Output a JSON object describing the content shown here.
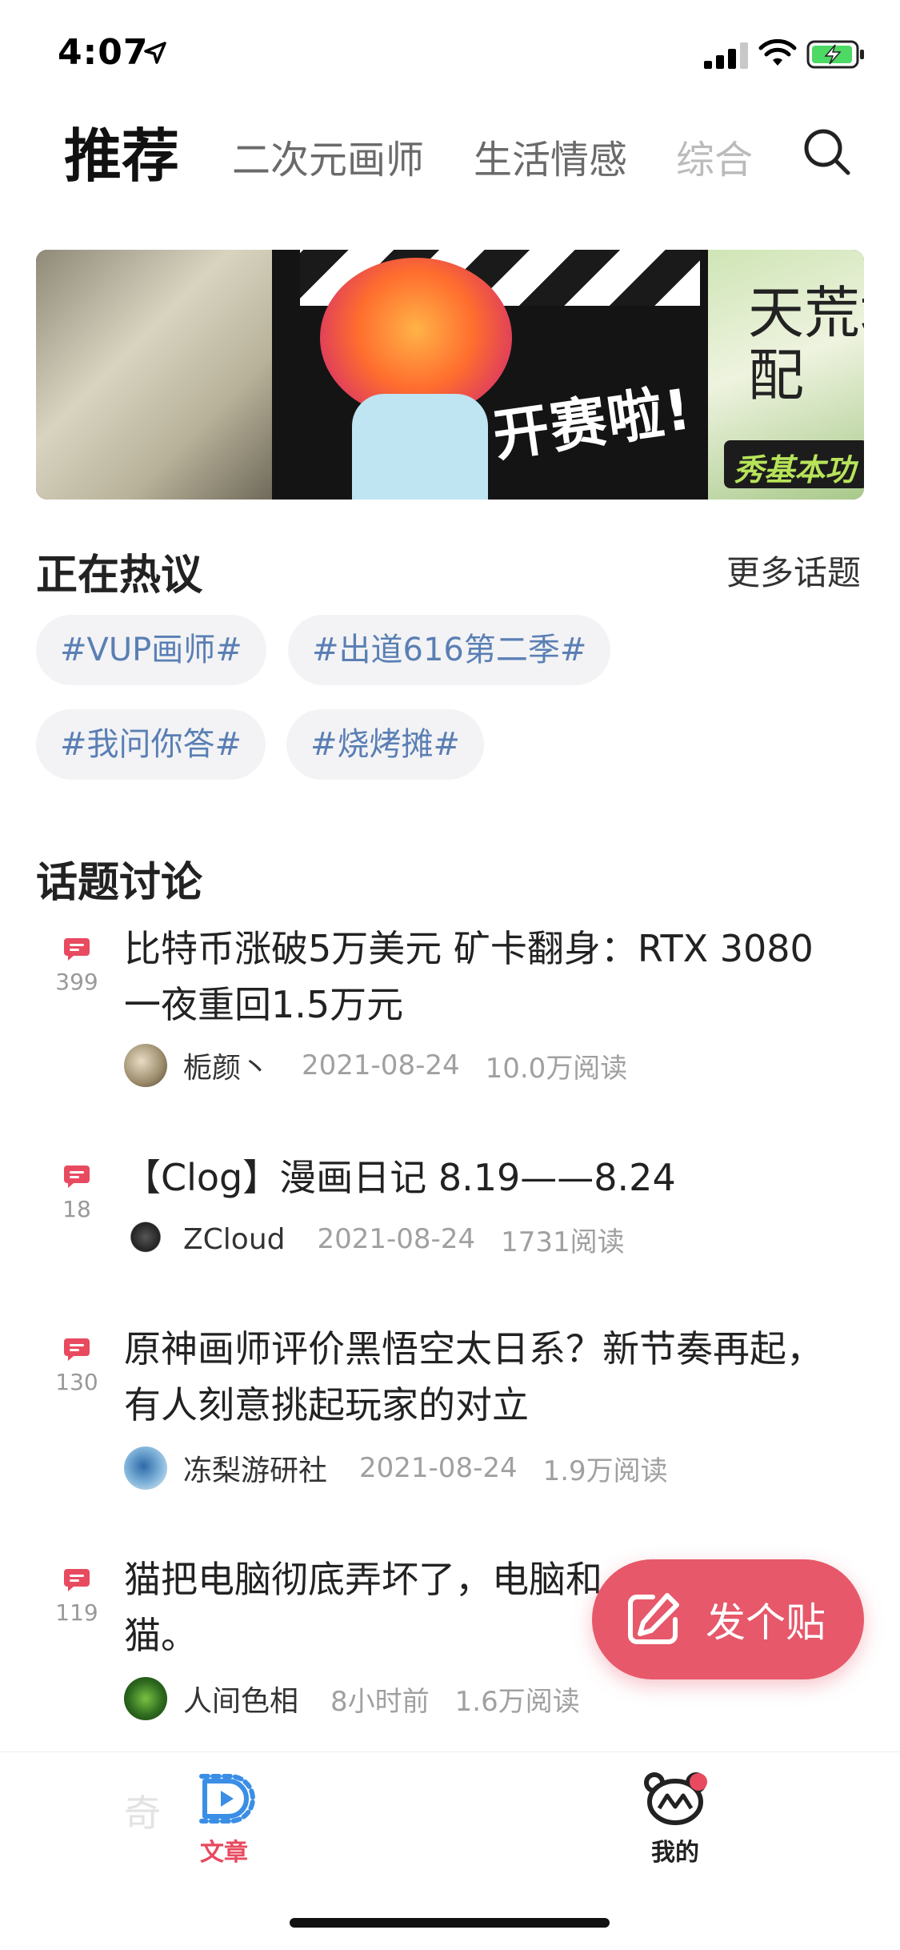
{
  "status_bar": {
    "time": "4:07"
  },
  "top_tabs": [
    {
      "label": "推荐",
      "active": true
    },
    {
      "label": "二次元画师",
      "active": false
    },
    {
      "label": "生活情感",
      "active": false
    },
    {
      "label": "综合",
      "active": false
    }
  ],
  "banner": {
    "headline": "开赛啦!",
    "side_title": "天荒地\n配",
    "tag_text": "秀基本功"
  },
  "hot_topics": {
    "title": "正在热议",
    "more_label": "更多话题",
    "chips": [
      "#VUP画师#",
      "#出道616第二季#",
      "#我问你答#",
      "#烧烤摊#"
    ]
  },
  "discussion": {
    "title": "话题讨论",
    "posts": [
      {
        "count": "399",
        "title": "比特币涨破5万美元 矿卡翻身：RTX 3080一夜重回1.5万元",
        "author": "栀颜丶",
        "date": "2021-08-24",
        "reads": "10.0万阅读"
      },
      {
        "count": "18",
        "title": "【Clog】漫画日记 8.19——8.24",
        "author": "ZCloud",
        "date": "2021-08-24",
        "reads": "1731阅读"
      },
      {
        "count": "130",
        "title": "原神画师评价黑悟空太日系？新节奏再起，有人刻意挑起玩家的对立",
        "author": "冻梨游研社",
        "date": "2021-08-24",
        "reads": "1.9万阅读"
      },
      {
        "count": "119",
        "title": "猫把电脑彻底弄坏了，电脑和猫。",
        "title_line1": "猫把电脑彻底弄坏了，电脑和",
        "title_line2": "猫。",
        "author": "人间色相",
        "date": "8小时前",
        "reads": "1.6万阅读"
      }
    ],
    "partial_title": "奇"
  },
  "fab": {
    "label": "发个贴"
  },
  "tabbar": [
    {
      "label": "文章",
      "active": true,
      "color": "#e84a5f"
    },
    {
      "label": "我的",
      "active": false,
      "color": "#222222"
    }
  ],
  "colors": {
    "accent": "#e6586a",
    "chip_text": "#5a7fb4",
    "chip_bg": "#f3f3f5"
  }
}
